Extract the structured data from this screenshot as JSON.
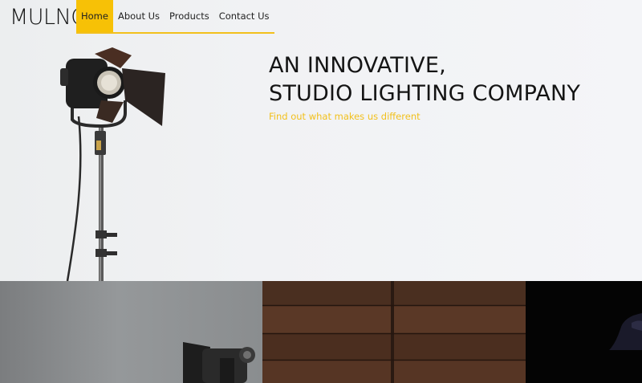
{
  "brand": {
    "name": "MULNO"
  },
  "nav": {
    "items": [
      {
        "label": "Home",
        "active": true
      },
      {
        "label": "About Us",
        "active": false
      },
      {
        "label": "Products",
        "active": false
      },
      {
        "label": "Contact Us",
        "active": false
      }
    ]
  },
  "hero": {
    "headline_line1": "AN INNOVATIVE,",
    "headline_line2": "STUDIO LIGHTING COMPANY",
    "subline": "Find out what makes us different"
  },
  "colors": {
    "accent": "#f7c106",
    "text": "#141414",
    "background": "#f3f4f7"
  },
  "images": [
    "studio-light-on-stand",
    "studio-light-closeup",
    "wooden-wall",
    "dark-lamp-silhouette"
  ]
}
